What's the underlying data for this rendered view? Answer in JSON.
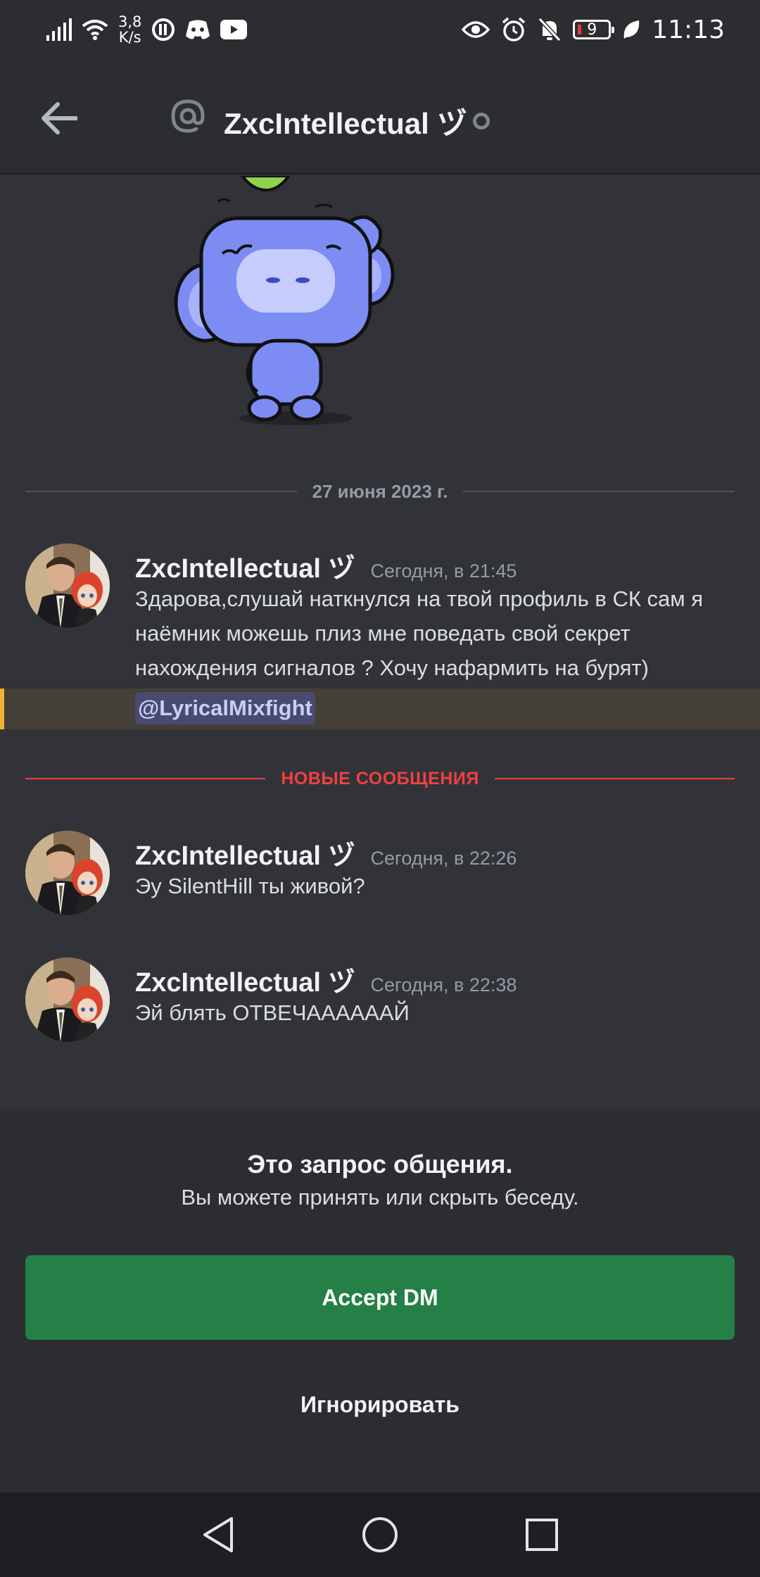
{
  "status_bar": {
    "net_speed_value": "3,8",
    "net_speed_unit": "K/s",
    "battery": "9",
    "time": "11:13"
  },
  "header": {
    "title": "ZxcIntellectual ヅ"
  },
  "date_divider": "27 июня 2023 г.",
  "new_messages_divider": "НОВЫЕ СООБЩЕНИЯ",
  "messages": [
    {
      "author": "ZxcIntellectual ヅ",
      "timestamp": "Сегодня, в 21:45",
      "text": "Здарова,слушай наткнулся на твой профиль в СК сам я наёмник можешь плиз мне поведать свой секрет нахождения сигналов ? Хочу нафармить на бурят)",
      "mention": "@LyricalMixfight"
    },
    {
      "author": "ZxcIntellectual ヅ",
      "timestamp": "Сегодня, в 22:26",
      "text": "Эу SilentHill ты живой?"
    },
    {
      "author": "ZxcIntellectual ヅ",
      "timestamp": "Сегодня, в 22:38",
      "text": "Эй блять ОТВЕЧААААААЙ"
    }
  ],
  "request": {
    "title": "Это запрос общения.",
    "subtitle": "Вы можете принять или скрыть беседу.",
    "accept_label": "Accept DM",
    "ignore_label": "Игнорировать"
  },
  "colors": {
    "background": "#313338",
    "panel": "#2b2d31",
    "accept": "#248046",
    "new_divider": "#f23f43",
    "mention_highlight": "#f0b232"
  }
}
